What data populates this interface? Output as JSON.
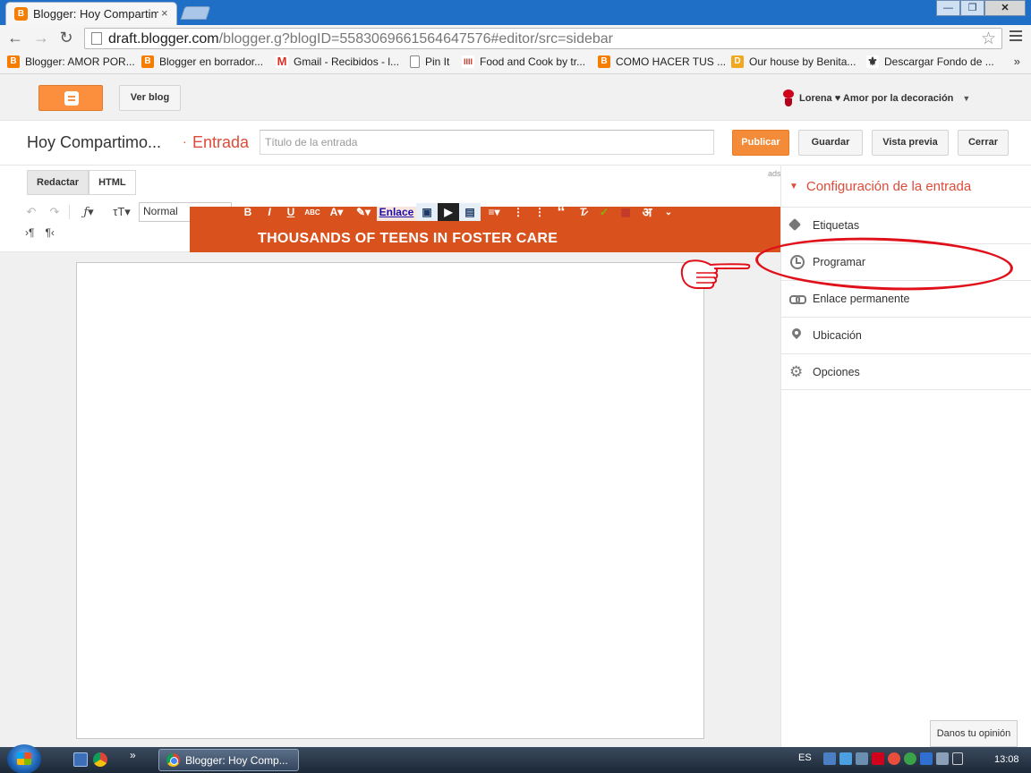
{
  "browser": {
    "tab_title": "Blogger: Hoy Compartimos lo",
    "tab_close": "×",
    "address_host": "draft.blogger.com",
    "address_path": "/blogger.g?blogID=5583069661564647576#editor/src=sidebar",
    "bookmarks": [
      {
        "label": "Blogger: AMOR POR...",
        "icon": "blogger-icon",
        "color": "#f57d00"
      },
      {
        "label": "Blogger en borrador...",
        "icon": "blogger-icon",
        "color": "#f57d00"
      },
      {
        "label": "Gmail - Recibidos - l...",
        "icon": "gmail-icon",
        "color": "#d93025"
      },
      {
        "label": "Pin It",
        "icon": "page-icon",
        "color": "#ffffff"
      },
      {
        "label": "Food and Cook by tr...",
        "icon": "fc-icon",
        "color": "#c0392b"
      },
      {
        "label": "COMO HACER TUS ...",
        "icon": "blogger-icon",
        "color": "#f57d00"
      },
      {
        "label": "Our house by Benita...",
        "icon": "d-icon",
        "color": "#f1a820"
      },
      {
        "label": "Descargar Fondo de ...",
        "icon": "fleur-icon",
        "color": "#333333"
      }
    ],
    "bookmarks_more": "»"
  },
  "blogger": {
    "ver_blog": "Ver blog",
    "user_name": "Lorena ♥ Amor por la decoración",
    "blog_name": "Hoy Compartimo...",
    "separator": "·",
    "section": "Entrada",
    "title_placeholder": "Título de la entrada",
    "buttons": {
      "publish": "Publicar",
      "save": "Guardar",
      "preview": "Vista previa",
      "close": "Cerrar"
    }
  },
  "editor": {
    "mode_tabs": [
      "Redactar",
      "HTML"
    ],
    "format_value": "Normal",
    "link_label": "Enlace",
    "ads_label": "ads",
    "ad_text": "THOUSANDS OF TEENS IN FOSTER CARE"
  },
  "sidebar": {
    "heading": "Configuración de la entrada",
    "items": [
      {
        "label": "Etiquetas",
        "icon": "tag-icon"
      },
      {
        "label": "Programar",
        "icon": "clock-icon"
      },
      {
        "label": "Enlace permanente",
        "icon": "link-icon"
      },
      {
        "label": "Ubicación",
        "icon": "location-pin-icon"
      },
      {
        "label": "Opciones",
        "icon": "gear-icon"
      }
    ]
  },
  "feedback": "Danos tu opinión",
  "taskbar": {
    "task_label": "Blogger: Hoy Comp...",
    "language": "ES",
    "clock": "13:08",
    "chevron": "»"
  },
  "colors": {
    "accent_orange": "#f48b38",
    "blogger_red": "#dd4b39",
    "highlight_red": "#e0101a",
    "ad_orange": "#d9521d"
  }
}
